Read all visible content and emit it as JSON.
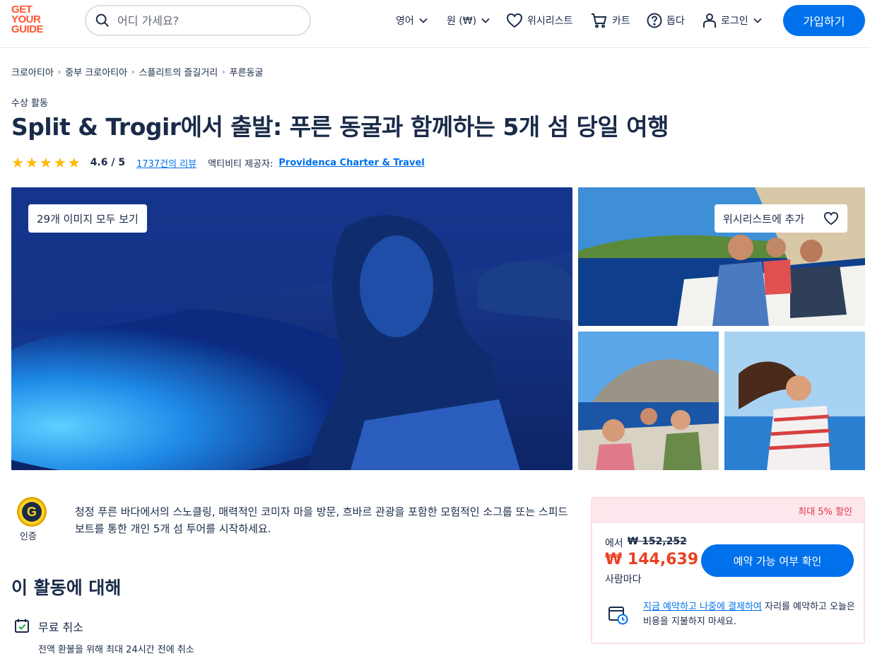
{
  "header": {
    "logo": [
      "GET",
      "YOUR",
      "GUIDE"
    ],
    "search_placeholder": "어디 가세요?",
    "language": "영어",
    "currency": "원 (₩)",
    "wishlist": "위시리스트",
    "cart": "카트",
    "help": "돕다",
    "login": "로그인",
    "signup": "가입하기"
  },
  "breadcrumb": [
    "크로아티아",
    "중부 크로아티아",
    "스플리트의 즐길거리",
    "푸른동굴"
  ],
  "activity": {
    "category": "수상 활동",
    "title": "Split & Trogir에서 출발: 푸른 동굴과 함께하는 5개 섬 당일 여행",
    "rating": "4.6 / 5",
    "stars": 4.6,
    "reviews": "1737건의 리뷰",
    "provider_label": "액티비티 제공자:",
    "provider": "Providenca Charter & Travel"
  },
  "gallery": {
    "see_all": "29개 이미지 모두 보기",
    "add_wishlist": "위시리스트에 추가"
  },
  "certified": {
    "badge_letter": "G",
    "label": "인증"
  },
  "description": "청정 푸른 바다에서의 스노클링, 매력적인 코미자 마을 방문, 흐바르 관광을 포함한 모험적인 소그룹 또는 스피드보트를 통한 개인 5개 섬 투어를 시작하세요.",
  "about": {
    "title": "이 활동에 대해",
    "feature_title": "무료 취소",
    "feature_desc": "전액 환불을 위해 최대 24시간 전에 취소"
  },
  "booking": {
    "discount": "최대 5% 할인",
    "from_label": "에서",
    "old_price": "₩ 152,252",
    "price": "₩ 144,639",
    "per_person": "사람마다",
    "check_button": "예약 가능 여부 확인",
    "reserve_link": "지금 예약하고 나중에 결제하여",
    "reserve_text": " 자리를 예약하고 오늘은 비용을 지불하지 마세요."
  },
  "colors": {
    "brand": "#ff5533",
    "primary": "#0071eb",
    "price": "#eb4024",
    "star": "#ffb800"
  }
}
